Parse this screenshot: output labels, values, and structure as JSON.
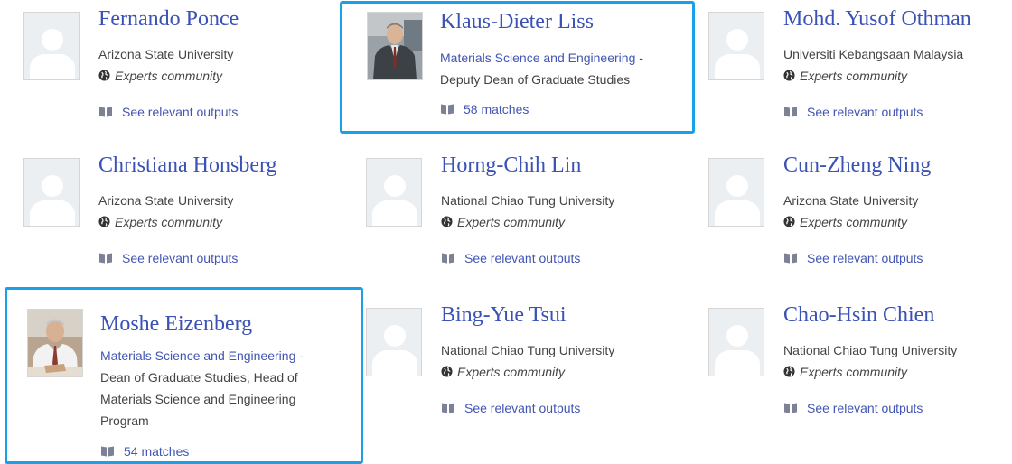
{
  "experts": [
    {
      "name": "Fernando Ponce",
      "affiliation": "Arizona State University",
      "community": "Experts community",
      "outputs": "See relevant outputs"
    },
    {
      "name": "Klaus-Dieter Liss",
      "department": "Materials Science and Engineering",
      "role_dash": " -",
      "role": "Deputy Dean of Graduate Studies",
      "matches": "58 matches"
    },
    {
      "name": "Mohd. Yusof Othman",
      "affiliation": "Universiti Kebangsaan Malaysia",
      "community": "Experts community",
      "outputs": "See relevant outputs"
    },
    {
      "name": "Christiana Honsberg",
      "affiliation": "Arizona State University",
      "community": "Experts community",
      "outputs": "See relevant outputs"
    },
    {
      "name": "Horng-Chih Lin",
      "affiliation": "National Chiao Tung University",
      "community": "Experts community",
      "outputs": "See relevant outputs"
    },
    {
      "name": "Cun-Zheng Ning",
      "affiliation": "Arizona State University",
      "community": "Experts community",
      "outputs": "See relevant outputs"
    },
    {
      "name": "Moshe Eizenberg",
      "department": "Materials Science and Engineering",
      "role_dash": " -",
      "role": "Dean of Graduate Studies, Head of Materials Science and Engineering Program",
      "matches": "54 matches"
    },
    {
      "name": "Bing-Yue Tsui",
      "affiliation": "National Chiao Tung University",
      "community": "Experts community",
      "outputs": "See relevant outputs"
    },
    {
      "name": "Chao-Hsin Chien",
      "affiliation": "National Chiao Tung University",
      "community": "Experts community",
      "outputs": "See relevant outputs"
    }
  ],
  "colors": {
    "link": "#3a51b5",
    "highlight": "#1aa0e8",
    "text": "#444444"
  },
  "icons": {
    "placeholder": "person-silhouette-icon",
    "globe": "globe-icon",
    "book": "book-icon"
  }
}
